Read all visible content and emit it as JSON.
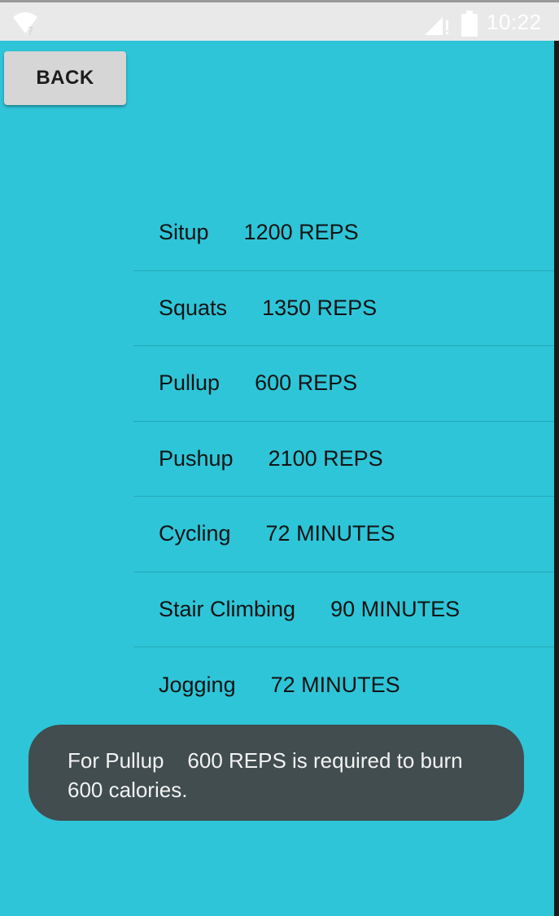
{
  "status_bar": {
    "time": "10:22",
    "icons": [
      "wifi-unknown-icon",
      "signal-icon",
      "battery-icon"
    ]
  },
  "app": {
    "back_label": "BACK",
    "exercises": [
      {
        "name": "Situp",
        "amount": "1200 REPS"
      },
      {
        "name": "Squats",
        "amount": "1350 REPS"
      },
      {
        "name": "Pullup",
        "amount": "600 REPS"
      },
      {
        "name": "Pushup",
        "amount": "2100 REPS"
      },
      {
        "name": "Cycling",
        "amount": "72 MINUTES"
      },
      {
        "name": "Stair Climbing",
        "amount": "90 MINUTES"
      },
      {
        "name": "Jogging",
        "amount": "72 MINUTES"
      }
    ]
  },
  "toast": {
    "message": "For Pullup    600 REPS is required to burn 600 calories."
  },
  "colors": {
    "background": "#2ec5d8",
    "status_bar": "#e9e9e9",
    "toast_background": "#414d4f",
    "button_background": "#d6d6d6"
  }
}
